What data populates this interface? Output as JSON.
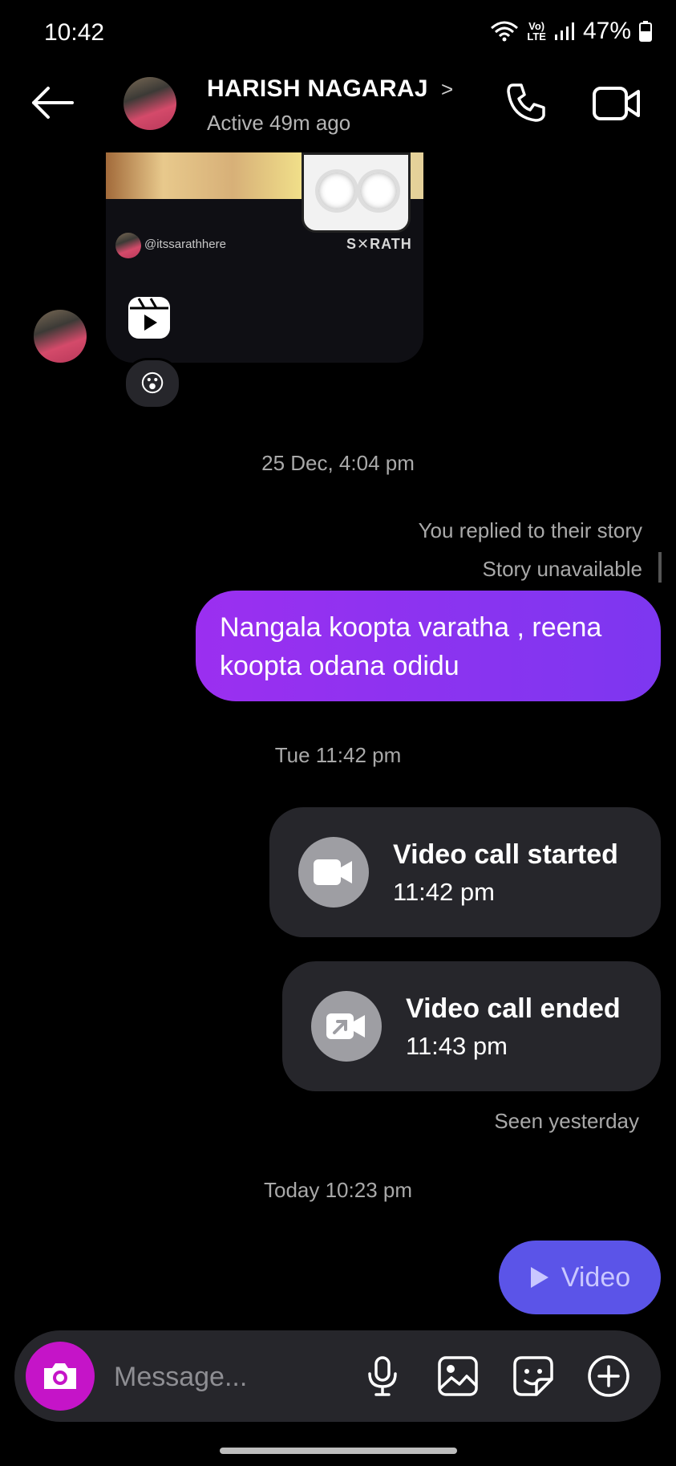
{
  "status_bar": {
    "time": "10:42",
    "battery": "47%",
    "lte_top": "Vo)",
    "lte_bottom": "LTE"
  },
  "header": {
    "name": "HARISH NAGARAJ",
    "chevron": ">",
    "status": "Active 49m ago"
  },
  "shared_reel": {
    "author": "@itssarathhere",
    "brand": "S✕RATH",
    "reaction": "😮"
  },
  "messages": {
    "stamp_1": "25 Dec, 4:04 pm",
    "story_reply_note": "You replied to their story",
    "story_unavailable": "Story unavailable",
    "sent_text": "Nangala koopta varatha , reena koopta odana odidu",
    "stamp_2": "Tue 11:42 pm",
    "call_started": {
      "title": "Video call started",
      "time": "11:42 pm"
    },
    "call_ended": {
      "title": "Video call ended",
      "time": "11:43 pm"
    },
    "seen": "Seen yesterday",
    "stamp_3": "Today 10:23 pm",
    "video_label": "Video"
  },
  "composer": {
    "placeholder": "Message..."
  },
  "colors": {
    "sent_bubble": "#8b33f0",
    "video_pill": "#5b54e8",
    "camera": "#c514c8",
    "card": "#26262b"
  },
  "icons": [
    "back-arrow-icon",
    "phone-icon",
    "video-camera-icon",
    "reels-icon",
    "camera-icon",
    "microphone-icon",
    "gallery-icon",
    "sticker-icon",
    "plus-circle-icon",
    "play-icon",
    "video-call-icon",
    "call-ended-icon",
    "wifi-icon",
    "signal-icon",
    "battery-icon"
  ]
}
